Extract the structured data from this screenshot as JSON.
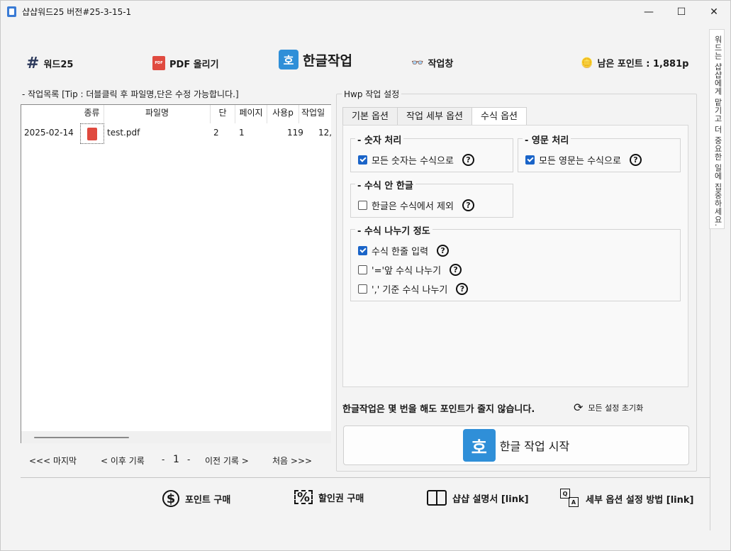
{
  "window": {
    "title": "샵샵워드25  버전#25-3-15-1",
    "minimize": "—",
    "maximize": "☐",
    "close": "✕"
  },
  "nav": {
    "word25": "워드25",
    "pdf_upload": "PDF 올리기",
    "hangul_work": "한글작업",
    "hangul_icon_char": "호",
    "workspace": "작업창",
    "points": "남은 포인트 : 1,881p"
  },
  "side_tab": "워드는 샵샵에게 맡기고 더 중요한 일에 집중하세요.",
  "worklist": {
    "title": "- 작업목록 [Tip : 더블클릭 후 파일명,단은 수정 가능합니다.]",
    "columns": [
      "종류",
      "파일명",
      "단",
      "페이지",
      "사용p",
      "작업일"
    ],
    "rows": [
      {
        "date": "2025-02-14",
        "filename": "test.pdf",
        "dan": "2",
        "pages": "1",
        "used": "119",
        "workdate": "12,"
      }
    ]
  },
  "pager": {
    "last": "<<< 마지막",
    "next": "< 이후 기록",
    "page": "1",
    "prev": "이전 기록 >",
    "first": "처음 >>>",
    "dash_left": "-",
    "dash_right": "-"
  },
  "hwp_settings": {
    "title": "Hwp 작업 설정",
    "tabs": [
      "기본 옵션",
      "작업 세부 옵션",
      "수식 옵션"
    ],
    "active_tab": 2,
    "groups": {
      "number": {
        "title": "- 숫자 처리",
        "option": "모든 숫자는 수식으로",
        "checked": true
      },
      "english": {
        "title": "- 영문 처리",
        "option": "모든 영문는 수식으로",
        "checked": true
      },
      "hangul_in_formula": {
        "title": "- 수식 안 한글",
        "option": "한글은 수식에서 제외",
        "checked": false
      },
      "split": {
        "title": "- 수식 나누기 정도",
        "options": [
          {
            "label": "수식 한줄 입력",
            "checked": true
          },
          {
            "label": "'='앞 수식 나누기",
            "checked": false
          },
          {
            "label": "',' 기준 수식 나누기",
            "checked": false
          }
        ]
      }
    },
    "notice": "한글작업은 몇 번을 해도 포인트가 줄지 않습니다.",
    "reset": "모든 설정 초기화",
    "start_button": "한글 작업 시작",
    "help_glyph": "?"
  },
  "bottom": {
    "buy_points": "포인트 구매",
    "buy_coupon": "할인권 구매",
    "manual": "샵샵 설명서 [link]",
    "options_help": "세부 옵션 설정 방법 [link]",
    "dollar": "$",
    "percent": "%",
    "q": "Q",
    "a": "A"
  }
}
